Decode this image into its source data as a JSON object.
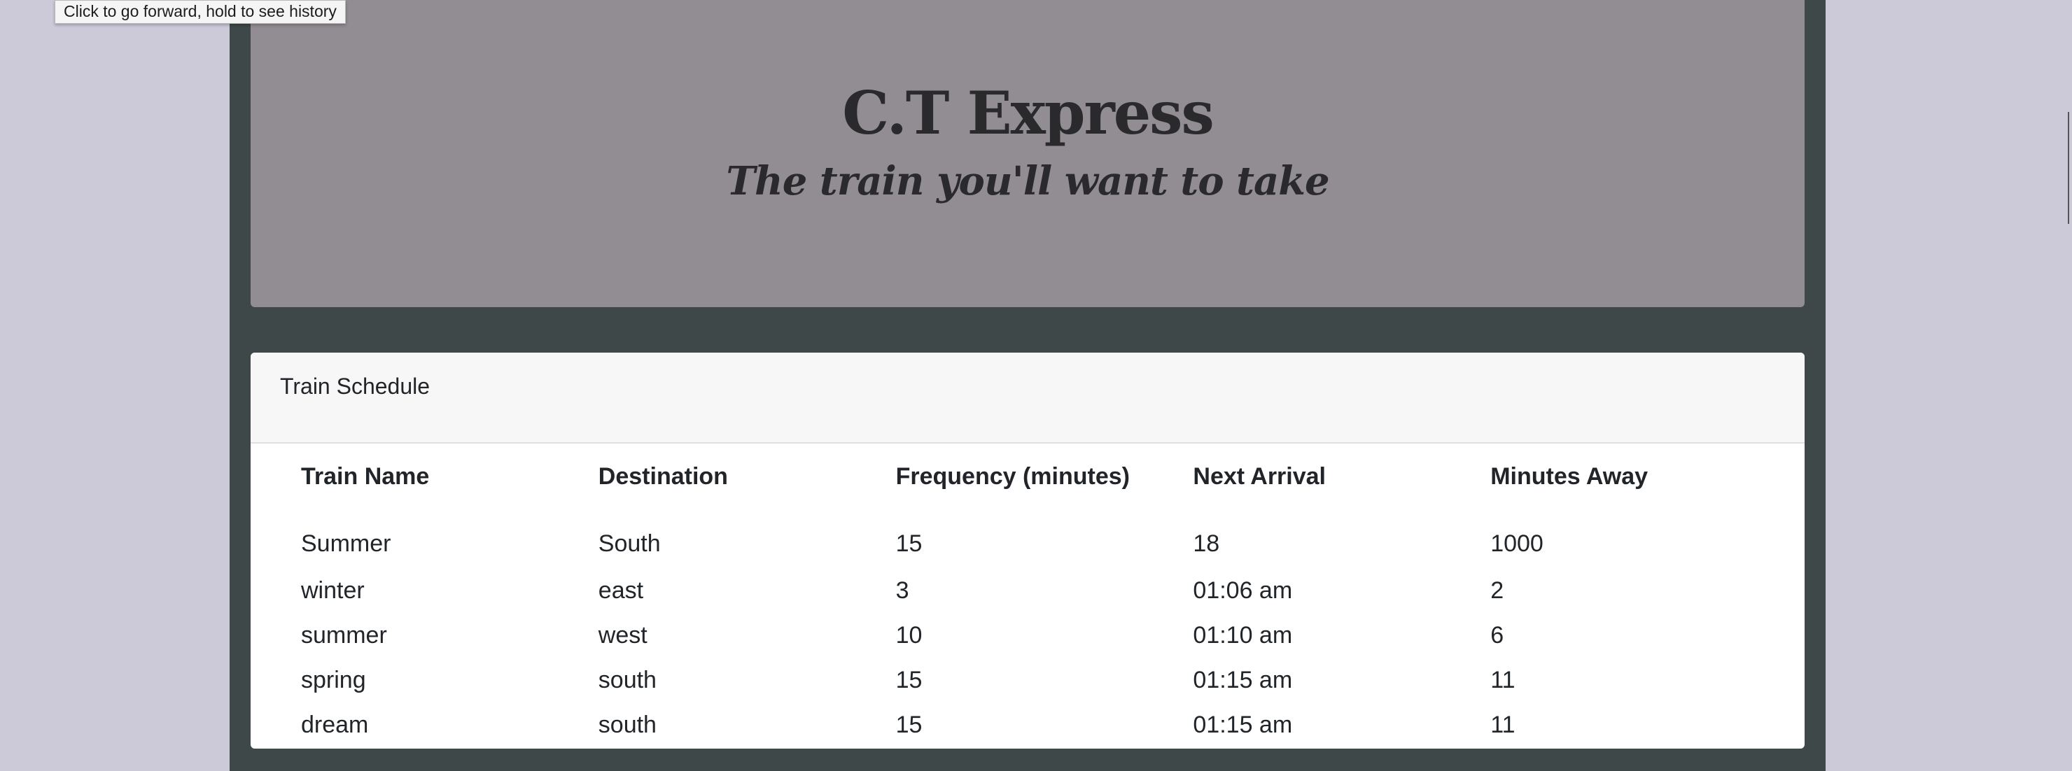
{
  "tooltip": {
    "text": "Click to go forward, hold to see history"
  },
  "header": {
    "title": "C.T Express",
    "subtitle": "The train you'll want to take"
  },
  "schedule": {
    "heading": "Train Schedule",
    "columns": [
      "Train Name",
      "Destination",
      "Frequency (minutes)",
      "Next Arrival",
      "Minutes Away"
    ],
    "rows": [
      [
        "Summer",
        "South",
        "15",
        "18",
        "1000"
      ],
      [
        "winter",
        "east",
        "3",
        "01:06 am",
        "2"
      ],
      [
        "summer",
        "west",
        "10",
        "01:10 am",
        "6"
      ],
      [
        "spring",
        "south",
        "15",
        "01:15 am",
        "11"
      ],
      [
        "dream",
        "south",
        "15",
        "01:15 am",
        "11"
      ]
    ]
  },
  "colors": {
    "page_background": "#cccad9",
    "container_background": "#3e4849",
    "jumbotron_background": "#928d93",
    "card_header_background": "#f7f7f7",
    "text": "#212529"
  }
}
